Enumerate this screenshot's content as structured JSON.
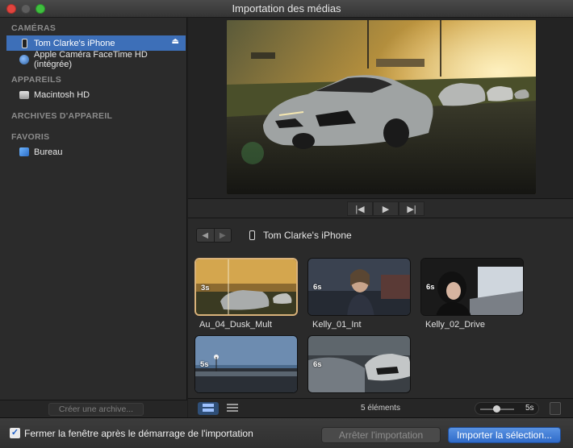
{
  "window": {
    "title": "Importation des médias"
  },
  "sidebar": {
    "sections": [
      {
        "heading": "CAMÉRAS",
        "items": [
          {
            "label": "Tom Clarke's iPhone",
            "icon": "iphone-icon",
            "selected": true,
            "eject": "⏏"
          },
          {
            "label": "Apple Caméra FaceTime HD (intégrée)",
            "icon": "facetime-camera-icon"
          }
        ]
      },
      {
        "heading": "APPAREILS",
        "items": [
          {
            "label": "Macintosh HD",
            "icon": "hard-drive-icon"
          }
        ]
      },
      {
        "heading": "ARCHIVES D'APPAREIL",
        "items": []
      },
      {
        "heading": "FAVORIS",
        "items": [
          {
            "label": "Bureau",
            "icon": "desktop-folder-icon"
          }
        ]
      }
    ],
    "archive_button": "Créer une archive..."
  },
  "browser": {
    "device_title": "Tom Clarke's iPhone",
    "clips": [
      {
        "name": "Au_04_Dusk_Mult",
        "duration": "3s",
        "selected": true
      },
      {
        "name": "Kelly_01_Int",
        "duration": "6s"
      },
      {
        "name": "Kelly_02_Drive",
        "duration": "6s"
      },
      {
        "name": "",
        "duration": "5s"
      },
      {
        "name": "",
        "duration": "6s"
      }
    ],
    "count_label": "5 éléments",
    "zoom_value": "5s"
  },
  "footer": {
    "close_checkbox_label": "Fermer la fenêtre après le démarrage de l'importation",
    "close_checkbox_checked": true,
    "stop_button": "Arrêter l'importation",
    "import_button": "Importer la sélection..."
  },
  "colors": {
    "selection": "#3d6fb8",
    "accent_button": "#2f6bc9",
    "clip_selected_border": "#d9b27a"
  }
}
